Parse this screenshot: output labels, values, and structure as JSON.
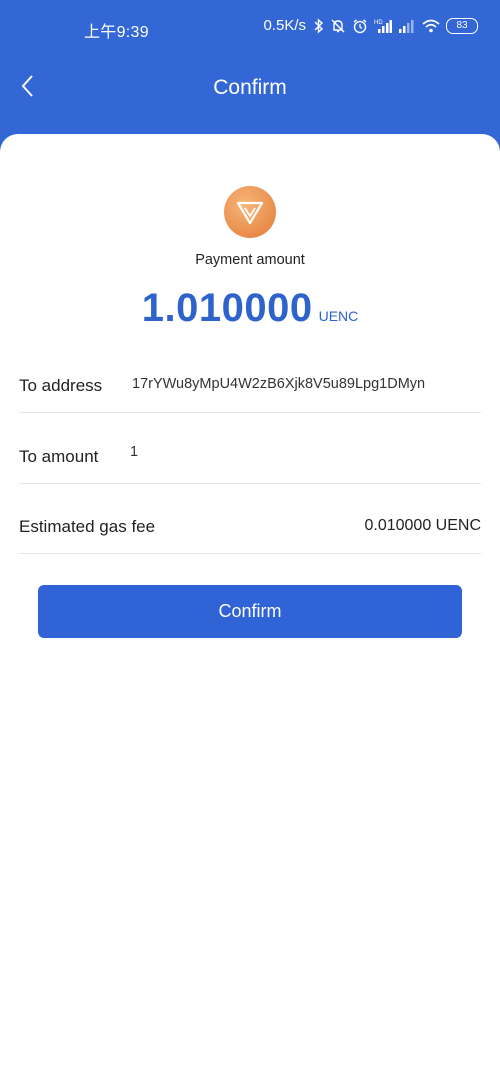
{
  "status_bar": {
    "time": "上午9:39",
    "net_speed": "0.5K/s",
    "battery": "83",
    "icons": [
      "bluetooth-icon",
      "mute-icon",
      "alarm-icon",
      "signal-hd-icon",
      "signal-icon",
      "wifi-icon",
      "battery-icon"
    ]
  },
  "header": {
    "back_icon": "chevron-left-icon",
    "title": "Confirm"
  },
  "payment": {
    "logo_icon": "uenc-logo-icon",
    "label": "Payment amount",
    "amount": "1.010000",
    "unit": "UENC"
  },
  "details": [
    {
      "label": "To address",
      "value": "17rYWu8yMpU4W2zB6Xjk8V5u89Lpg1DMyn"
    },
    {
      "label": "To amount",
      "value": "1"
    },
    {
      "label": "Estimated gas fee",
      "value": "0.010000 UENC"
    }
  ],
  "confirm_button": "Confirm",
  "colors": {
    "primary": "#3467d6",
    "button": "#2f63d6",
    "amount": "#2f63cc",
    "logo": "#e98c4a"
  }
}
